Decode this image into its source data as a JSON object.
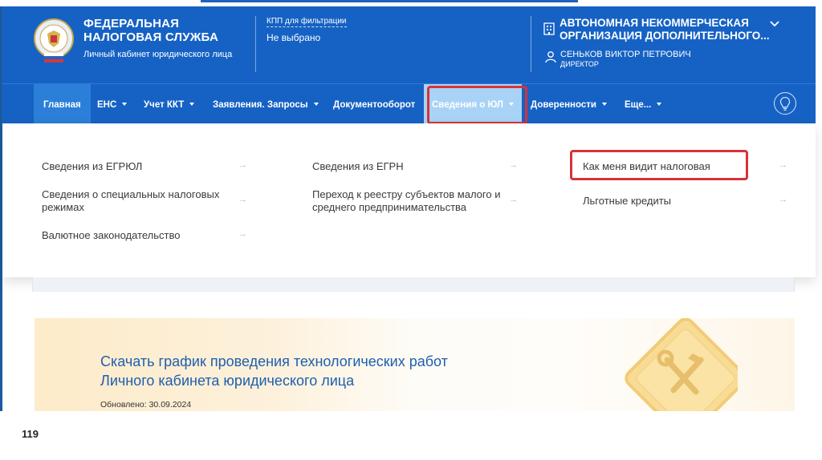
{
  "header": {
    "org_title_line1": "ФЕДЕРАЛЬНАЯ",
    "org_title_line2": "НАЛОГОВАЯ СЛУЖБА",
    "org_subtitle": "Личный кабинет юридического лица",
    "kpp_label": "КПП для фильтрации",
    "kpp_value": "Не выбрано",
    "company_line1": "АВТОНОМНАЯ НЕКОММЕРЧЕСКАЯ",
    "company_line2": "ОРГАНИЗАЦИЯ ДОПОЛНИТЕЛЬНОГО...",
    "person_name": "СЕНЬКОВ ВИКТОР ПЕТРОВИЧ",
    "person_role": "ДИРЕКТОР"
  },
  "nav": {
    "items": [
      {
        "label": "Главная"
      },
      {
        "label": "ЕНС"
      },
      {
        "label": "Учет ККТ"
      },
      {
        "label": "Заявления. Запросы"
      },
      {
        "label": "Документооборот"
      },
      {
        "label": "Сведения о ЮЛ"
      },
      {
        "label": "Доверенности"
      },
      {
        "label": "Еще..."
      }
    ]
  },
  "dropdown": {
    "col1": [
      {
        "label": "Сведения из ЕГРЮЛ"
      },
      {
        "label_line1": "Сведения о специальных налоговых",
        "label_line2": "режимах"
      },
      {
        "label": "Валютное законодательство"
      }
    ],
    "col2": [
      {
        "label": "Сведения из ЕГРН"
      },
      {
        "label_line1": "Переход к реестру субъектов малого и",
        "label_line2": "среднего предпринимательства"
      }
    ],
    "col3": [
      {
        "label": "Как меня видит налоговая"
      },
      {
        "label": "Льготные кредиты"
      }
    ],
    "arrow": "→"
  },
  "banner": {
    "title_line1": "Скачать график проведения технологических работ",
    "title_line2": "Личного кабинета юридического лица",
    "updated": "Обновлено: 30.09.2024"
  },
  "page_number": "119",
  "colors": {
    "header_bg": "#1662c4",
    "nav_active": "#2b7fd8",
    "nav_highlight": "#a9d3f6",
    "callout_red": "#d6333a",
    "link_blue": "#1e5fae"
  },
  "icons": [
    "fns-emblem-icon",
    "building-icon",
    "chevron-down-icon",
    "user-icon",
    "lightbulb-icon",
    "arrow-right-icon",
    "road-works-sign-icon"
  ]
}
